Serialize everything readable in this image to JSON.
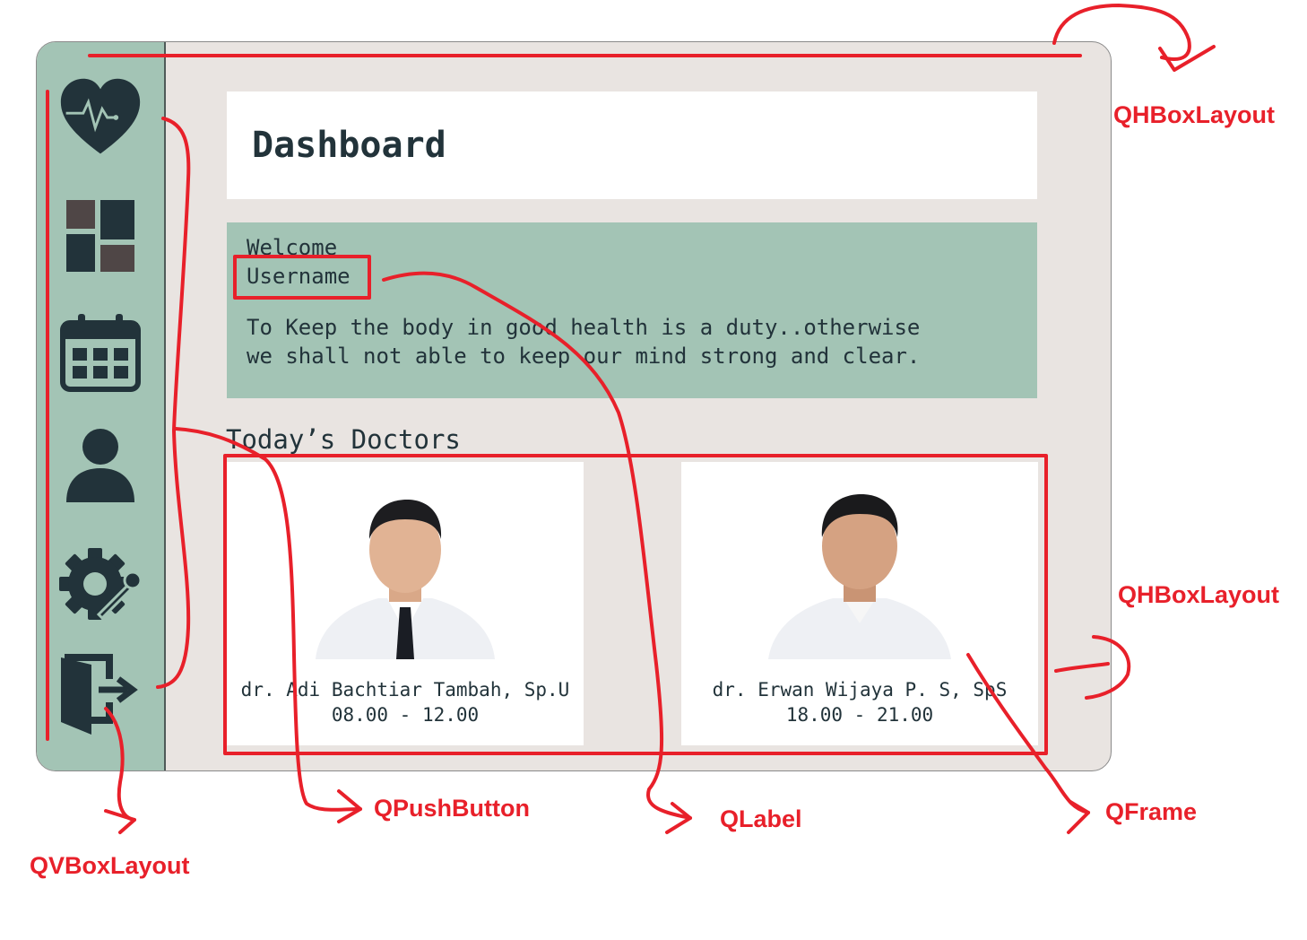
{
  "dashboard": {
    "title": "Dashboard",
    "welcome_label": "Welcome",
    "username": "Username",
    "quote_line1": "To Keep the body in good health is a duty..otherwise",
    "quote_line2": "we shall not able to keep our mind strong and clear.",
    "doctors_heading": "Today’s Doctors",
    "doctors": [
      {
        "name": "dr. Adi Bachtiar Tambah, Sp.U",
        "time": "08.00 - 12.00"
      },
      {
        "name": "dr. Erwan Wijaya P. S, SpS",
        "time": "18.00 - 21.00"
      }
    ]
  },
  "sidebar": {
    "icons": [
      "heart-pulse-icon",
      "dashboard-grid-icon",
      "calendar-icon",
      "user-icon",
      "settings-icon",
      "logout-icon"
    ]
  },
  "annotations": {
    "hbox_top": "QHBoxLayout",
    "hbox_cards": "QHBoxLayout",
    "vbox": "QVBoxLayout",
    "pushbutton": "QPushButton",
    "label": "QLabel",
    "frame": "QFrame"
  },
  "colors": {
    "sidebar": "#a3c4b5",
    "background": "#e9e4e1",
    "icon": "#22333a",
    "annotation": "#e8202a"
  }
}
